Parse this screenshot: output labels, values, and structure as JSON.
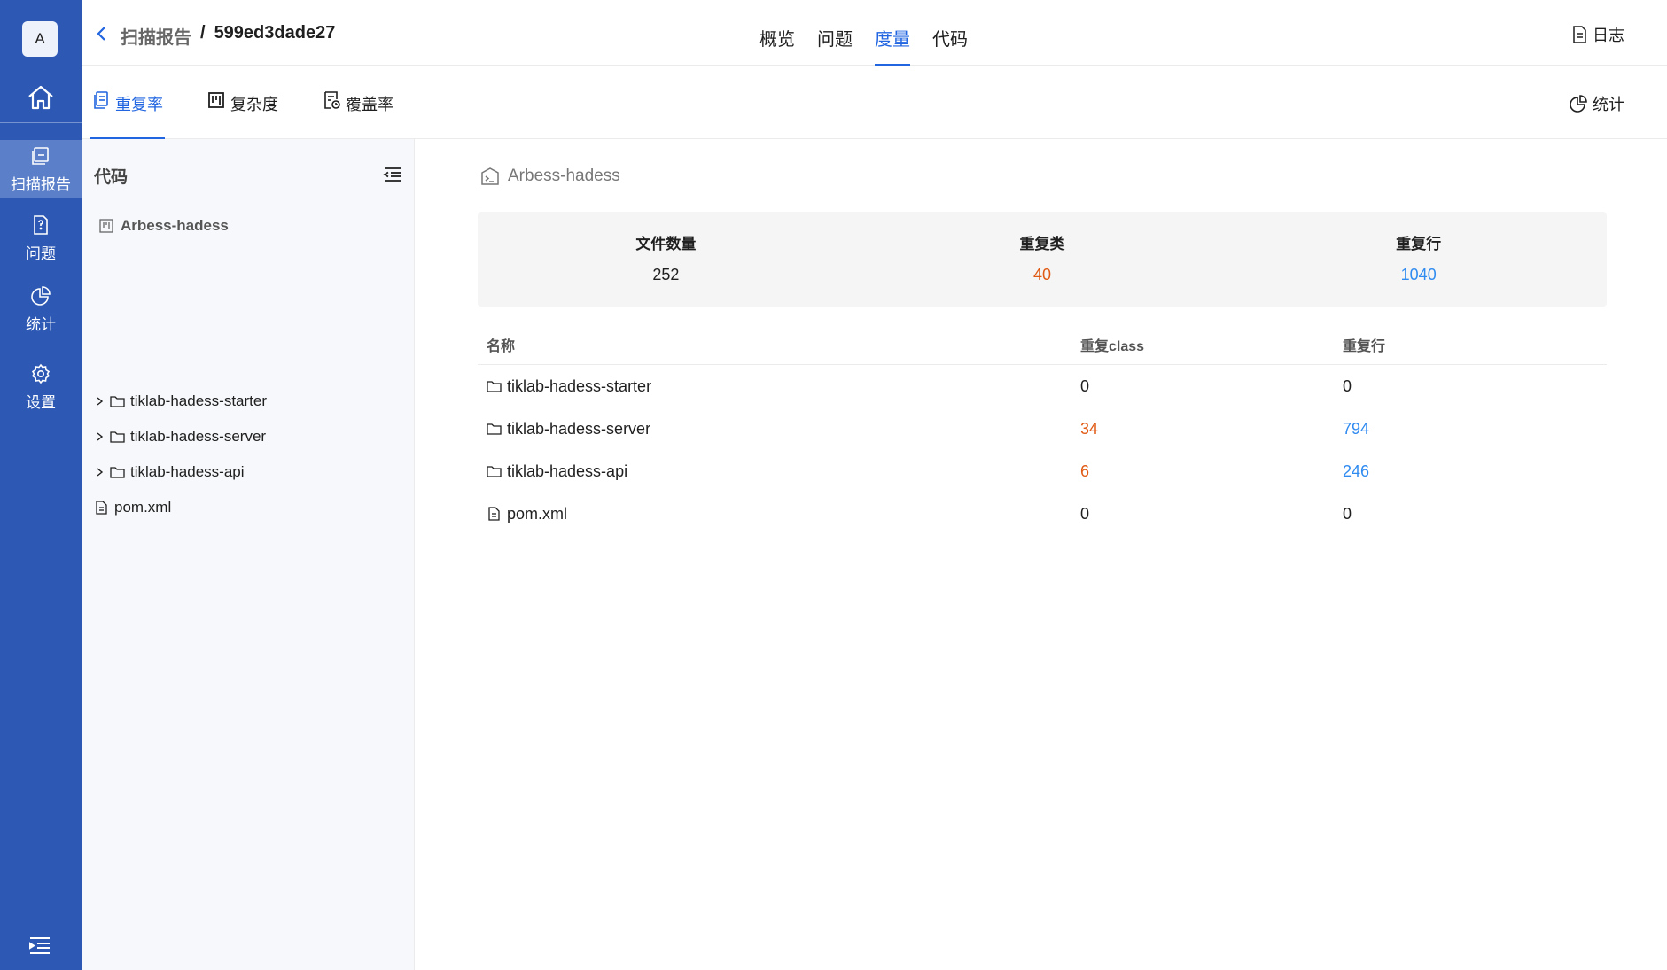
{
  "rail": {
    "avatar": "A",
    "items": [
      {
        "label": "扫描报告",
        "icon": "report-icon"
      },
      {
        "label": "问题",
        "icon": "issue-icon"
      },
      {
        "label": "统计",
        "icon": "pie-chart-icon"
      },
      {
        "label": "设置",
        "icon": "gear-icon"
      }
    ]
  },
  "header": {
    "breadcrumb_parent": "扫描报告",
    "breadcrumb_sep": "/",
    "breadcrumb_current": "599ed3dade27",
    "tabs": [
      {
        "label": "概览"
      },
      {
        "label": "问题"
      },
      {
        "label": "度量"
      },
      {
        "label": "代码"
      }
    ],
    "active_tab": "度量",
    "log_label": "日志"
  },
  "subheader": {
    "tabs": [
      {
        "label": "重复率",
        "icon": "duplicate-icon"
      },
      {
        "label": "复杂度",
        "icon": "kanban-icon"
      },
      {
        "label": "覆盖率",
        "icon": "coverage-icon"
      }
    ],
    "active_tab": "重复率",
    "stat_label": "统计"
  },
  "tree": {
    "title": "代码",
    "root": "Arbess-hadess",
    "nodes": [
      {
        "label": "tiklab-hadess-starter",
        "type": "folder"
      },
      {
        "label": "tiklab-hadess-server",
        "type": "folder"
      },
      {
        "label": "tiklab-hadess-api",
        "type": "folder"
      },
      {
        "label": "pom.xml",
        "type": "file"
      }
    ]
  },
  "main": {
    "project": "Arbess-hadess",
    "summary": [
      {
        "label": "文件数量",
        "value": "252"
      },
      {
        "label": "重复类",
        "value": "40"
      },
      {
        "label": "重复行",
        "value": "1040"
      }
    ],
    "columns": [
      "名称",
      "重复class",
      "重复行"
    ],
    "rows": [
      {
        "name": "tiklab-hadess-starter",
        "type": "folder",
        "dup_class": "0",
        "dup_lines": "0"
      },
      {
        "name": "tiklab-hadess-server",
        "type": "folder",
        "dup_class": "34",
        "dup_lines": "794"
      },
      {
        "name": "tiklab-hadess-api",
        "type": "folder",
        "dup_class": "6",
        "dup_lines": "246"
      },
      {
        "name": "pom.xml",
        "type": "file",
        "dup_class": "0",
        "dup_lines": "0"
      }
    ]
  },
  "colors": {
    "rail": "#2d59b5",
    "accent": "#2165e0",
    "orange": "#e05a14",
    "blue": "#2f8bf0"
  }
}
